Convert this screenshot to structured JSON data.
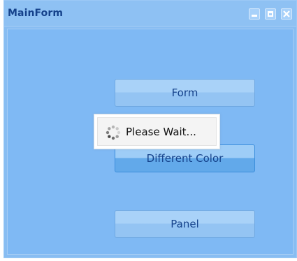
{
  "window": {
    "title": "MainForm",
    "controls": [
      "minimize-icon",
      "maximize-icon",
      "close-icon"
    ]
  },
  "buttons": {
    "form": "Form",
    "different_color": "Different Color",
    "panel": "Panel"
  },
  "loading": {
    "text": "Please Wait...",
    "icon": "spinner-icon"
  },
  "colors": {
    "title_text": "#15428b",
    "window_bg": "#88bdf2",
    "accent_button": "#62a9ea"
  }
}
